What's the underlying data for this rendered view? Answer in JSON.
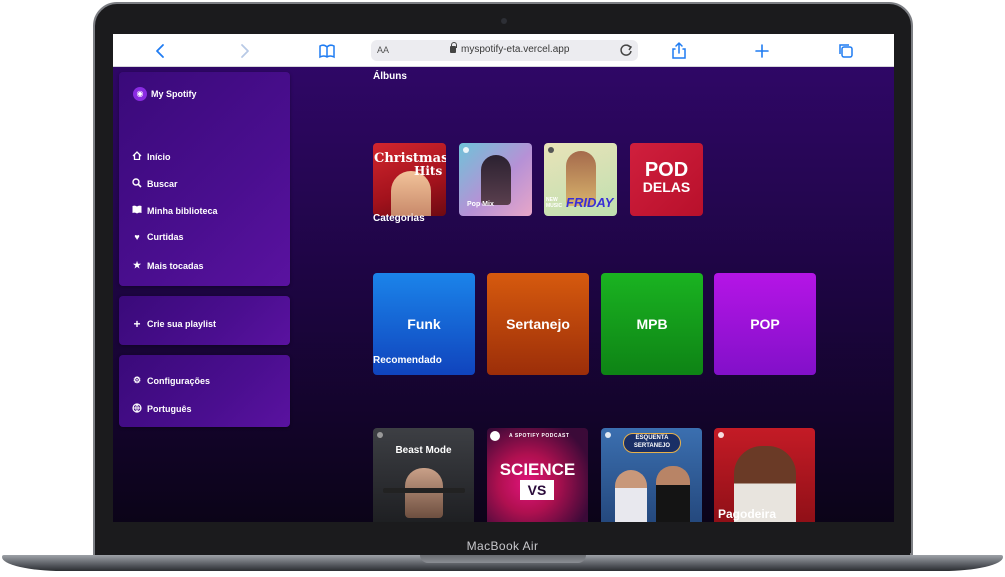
{
  "device": {
    "label": "MacBook Air"
  },
  "browser": {
    "aa_label": "AA",
    "url": "myspotify-eta.vercel.app",
    "back_icon": "chevron-left-icon",
    "forward_icon": "chevron-right-icon",
    "bookmarks_icon": "book-icon",
    "reload_icon": "reload-icon",
    "share_icon": "share-icon",
    "new_tab_icon": "plus-icon",
    "tabs_icon": "tabs-icon",
    "accent_color": "#1f7cf2"
  },
  "app": {
    "name": "My Spotify",
    "nav": [
      {
        "label": "Início",
        "icon": "home-icon"
      },
      {
        "label": "Buscar",
        "icon": "search-icon"
      },
      {
        "label": "Minha biblioteca",
        "icon": "library-icon"
      },
      {
        "label": "Curtidas",
        "icon": "heart-icon"
      },
      {
        "label": "Mais tocadas",
        "icon": "star-icon"
      }
    ],
    "create_playlist": {
      "label": "Crie sua playlist",
      "icon": "plus-icon"
    },
    "settings": [
      {
        "label": "Configurações",
        "icon": "gear-icon"
      },
      {
        "label": "Português",
        "icon": "globe-icon"
      }
    ]
  },
  "sections": {
    "albums": {
      "title": "Álbuns",
      "items": [
        {
          "line1": "Christmas",
          "line2": "Hits"
        },
        {
          "caption": "Pop Mix"
        },
        {
          "caption": "FRIDAY",
          "small": "NEW MUSIC"
        },
        {
          "line1": "POD",
          "line2": "DELAS"
        }
      ]
    },
    "categories": {
      "title": "Categorias",
      "items": [
        {
          "label": "Funk",
          "color": "#1468e0"
        },
        {
          "label": "Sertanejo",
          "color": "#c04a0c"
        },
        {
          "label": "MPB",
          "color": "#14a01c"
        },
        {
          "label": "POP",
          "color": "#a114dc"
        }
      ]
    },
    "recommended": {
      "title": "Recomendado",
      "items": [
        {
          "label": "Beast Mode"
        },
        {
          "small": "A SPOTIFY PODCAST",
          "line1": "SCIENCE",
          "line2": "VS"
        },
        {
          "line1": "ESQUENTA",
          "line2": "SERTANEJO"
        },
        {
          "label": "Pagodeira"
        }
      ]
    }
  }
}
